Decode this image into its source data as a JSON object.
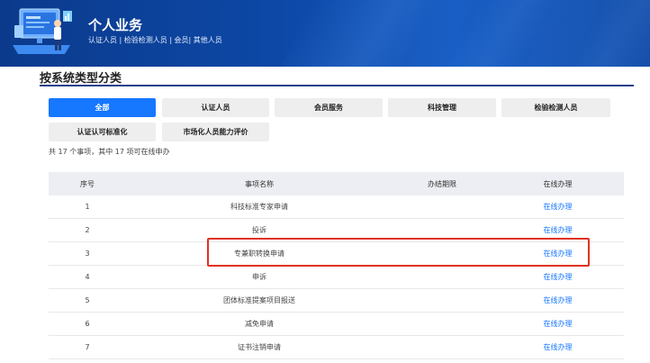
{
  "header": {
    "title": "个人业务",
    "subtitle": "认证人员 | 检验检测人员 | 会员| 其他人员"
  },
  "section": {
    "title": "按系统类型分类"
  },
  "categories": [
    {
      "label": "全部",
      "active": true
    },
    {
      "label": "认证人员",
      "active": false
    },
    {
      "label": "会员服务",
      "active": false
    },
    {
      "label": "科技管理",
      "active": false
    },
    {
      "label": "检验检测人员",
      "active": false
    },
    {
      "label": "认证认可标准化",
      "active": false
    },
    {
      "label": "市场化人员能力评价",
      "active": false
    }
  ],
  "summary": "共 17 个事项，其中 17 项可在线申办",
  "table": {
    "headers": [
      "序号",
      "事项名称",
      "办结期限",
      "在线办理"
    ],
    "rows": [
      {
        "num": "1",
        "name": "科技标准专家申请",
        "deadline": "",
        "action": "在线办理"
      },
      {
        "num": "2",
        "name": "投诉",
        "deadline": "",
        "action": "在线办理"
      },
      {
        "num": "3",
        "name": "专兼职转换申请",
        "deadline": "",
        "action": "在线办理"
      },
      {
        "num": "4",
        "name": "申诉",
        "deadline": "",
        "action": "在线办理"
      },
      {
        "num": "5",
        "name": "团体标准提案项目报送",
        "deadline": "",
        "action": "在线办理"
      },
      {
        "num": "6",
        "name": "减免申请",
        "deadline": "",
        "action": "在线办理"
      },
      {
        "num": "7",
        "name": "证书注销申请",
        "deadline": "",
        "action": "在线办理"
      }
    ]
  },
  "colors": {
    "banner": "#0d49a8",
    "accent": "#1677ff",
    "highlight": "#e0321f",
    "section_line": "#1f3f87"
  }
}
